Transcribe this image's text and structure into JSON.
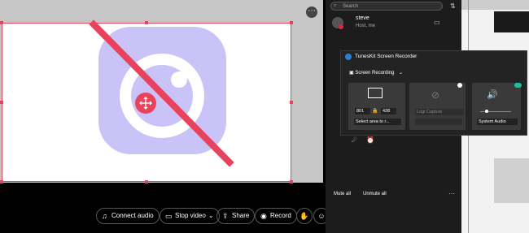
{
  "meeting": {
    "more_label": "⋯"
  },
  "toolbar": {
    "connect_audio": "Connect audio",
    "stop_video": "Stop video",
    "share": "Share",
    "record": "Record"
  },
  "participants": {
    "search_placeholder": "Search",
    "user_name": "steve",
    "user_role": "Host, me"
  },
  "recorder": {
    "title": "TunesKit Screen Recorder",
    "mode": "Screen Recording",
    "width": "801",
    "height": "438",
    "area_select": "Select area to r...",
    "logi_capture": "Logi Capture",
    "audio_select": "System Audio"
  },
  "footer": {
    "mute_all": "Mute all",
    "unmute_all": "Unmute all",
    "more": "⋯"
  },
  "colors": {
    "accent_red": "#e8425c",
    "app_icon": "#c9c3f7",
    "leave_red": "#e0243c"
  }
}
